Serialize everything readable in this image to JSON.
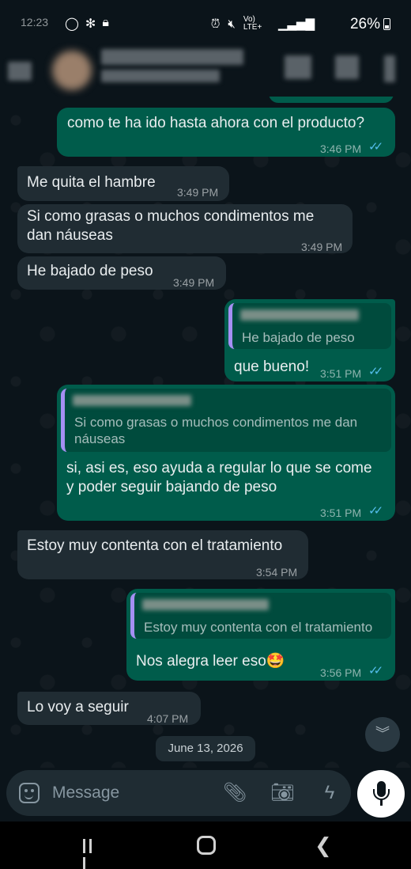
{
  "statusbar": {
    "time": "12:23",
    "left_icons": [
      "whatsapp-icon",
      "fan-icon",
      "lock-icon"
    ],
    "right_icons": [
      "alarm-icon",
      "mute-icon",
      "volte-icon",
      "signal-icon"
    ],
    "volte": "Vo) LTE+",
    "battery": "26%"
  },
  "header": {
    "contact_name_hidden": true
  },
  "messages": [
    {
      "dir": "out",
      "text": "como te ha ido hasta ahora con el producto?",
      "time": "3:46 PM"
    },
    {
      "dir": "in",
      "text": "Me quita el hambre",
      "time": "3:49 PM"
    },
    {
      "dir": "in",
      "text": "Si como grasas o muchos condimentos me dan náuseas",
      "time": "3:49 PM"
    },
    {
      "dir": "in",
      "text": "He bajado de peso",
      "time": "3:49 PM"
    },
    {
      "dir": "out",
      "quote": "He bajado de peso",
      "text": "que bueno!",
      "time": "3:51 PM"
    },
    {
      "dir": "out",
      "quote": "Si como grasas o muchos condimentos me dan náuseas",
      "text": "si, asi es, eso ayuda a regular lo que se come y poder seguir bajando de peso",
      "time": "3:51 PM"
    },
    {
      "dir": "in",
      "text": "Estoy muy contenta con el tratamiento",
      "time": "3:54 PM"
    },
    {
      "dir": "out",
      "quote": "Estoy muy contenta con el tratamiento",
      "text": "Nos alegra leer eso",
      "emoji": "🤩",
      "time": "3:56 PM"
    },
    {
      "dir": "in",
      "text": "Lo voy a seguir",
      "time": "4:07 PM"
    }
  ],
  "date_chip": "June 13, 2026",
  "input": {
    "placeholder": "Message",
    "icons": [
      "sticker-icon",
      "attach-icon",
      "camera-icon",
      "lightning-icon",
      "mic-icon"
    ]
  },
  "colors": {
    "background": "#0b141a",
    "incoming_bubble": "#202c33",
    "outgoing_bubble": "#005c4b",
    "read_ticks": "#53bdeb",
    "quote_bar": "#a58ff3"
  }
}
